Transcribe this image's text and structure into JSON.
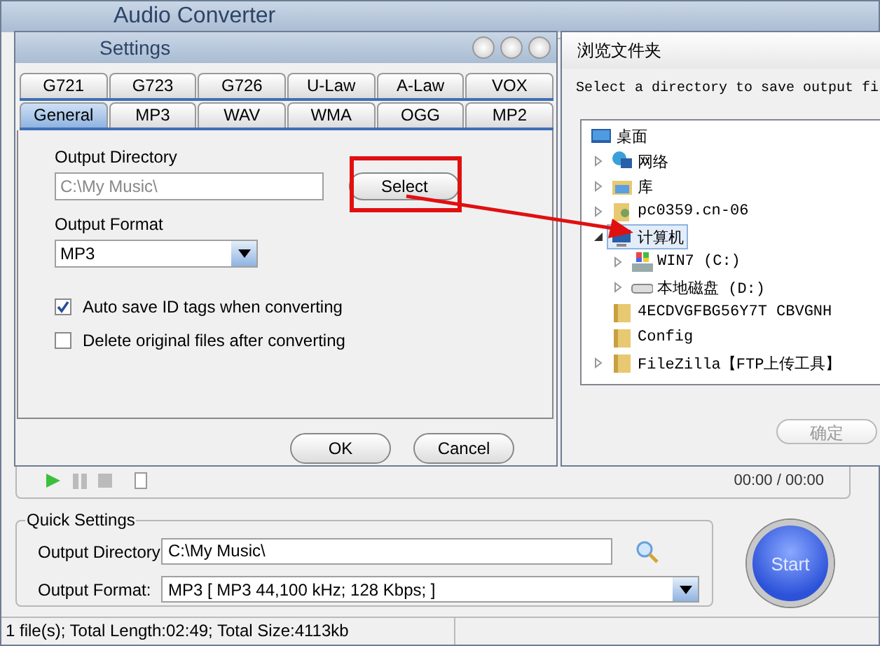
{
  "main_window": {
    "title": "Audio Converter",
    "player": {
      "time": "00:00 / 00:00"
    },
    "quick_settings": {
      "title": "Quick Settings",
      "output_directory_label": "Output Directory",
      "output_directory": "C:\\My Music\\",
      "output_format_label": "Output Format:",
      "output_format": "MP3  [ MP3 44,100 kHz;  128 Kbps;  ]"
    },
    "start_button": "Start",
    "status_bar": [
      "1 file(s); Total Length:02:49; Total Size:4113kb"
    ]
  },
  "settings_dialog": {
    "title": "Settings",
    "tab_rows": [
      [
        {
          "label": "G721",
          "selected": false
        },
        {
          "label": "G723",
          "selected": false
        },
        {
          "label": "G726",
          "selected": false
        },
        {
          "label": "U-Law",
          "selected": false
        },
        {
          "label": "A-Law",
          "selected": false
        },
        {
          "label": "VOX",
          "selected": false
        }
      ],
      [
        {
          "label": "General",
          "selected": true
        },
        {
          "label": "MP3",
          "selected": false
        },
        {
          "label": "WAV",
          "selected": false
        },
        {
          "label": "WMA",
          "selected": false
        },
        {
          "label": "OGG",
          "selected": false
        },
        {
          "label": "MP2",
          "selected": false
        }
      ]
    ],
    "output_directory_label": "Output Directory",
    "output_directory": "C:\\My Music\\",
    "select_button": "Select",
    "output_format_label": "Output Format",
    "output_format": "MP3",
    "checkboxes": [
      {
        "label": "Auto save ID tags when  converting",
        "checked": true
      },
      {
        "label": "Delete original files after converting",
        "checked": false
      }
    ],
    "buttons": [
      "OK",
      "Cancel"
    ]
  },
  "browse_dialog": {
    "title": "浏览文件夹",
    "prompt": "Select a directory to save output fi",
    "tree": [
      {
        "label": "桌面",
        "kind": "desktop",
        "selected": false,
        "children": [
          {
            "label": "网络",
            "kind": "network",
            "expanded": false,
            "selected": false
          },
          {
            "label": "库",
            "kind": "library",
            "expanded": false,
            "selected": false
          },
          {
            "label": "pc0359.cn-06",
            "kind": "user",
            "expanded": false,
            "selected": false
          },
          {
            "label": "计算机",
            "kind": "computer",
            "expanded": true,
            "selected": true,
            "children": [
              {
                "label": "WIN7 (C:)",
                "kind": "system-drive",
                "expanded": false,
                "selected": false
              },
              {
                "label": "本地磁盘 (D:)",
                "kind": "drive",
                "expanded": false,
                "selected": false
              }
            ]
          },
          {
            "label": "4ECDVGFBG56Y7T CBVGNH",
            "kind": "folder",
            "selected": false
          },
          {
            "label": "Config",
            "kind": "folder",
            "selected": false
          },
          {
            "label": "FileZilla【FTP上传工具】",
            "kind": "folder",
            "expanded": false,
            "selected": false
          }
        ]
      }
    ],
    "ok_button": "确定",
    "ok_disabled": true
  }
}
